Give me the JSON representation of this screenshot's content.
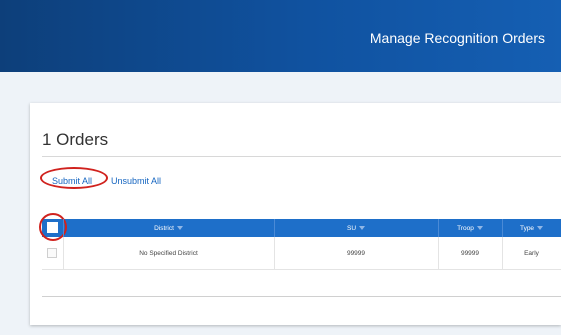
{
  "header": {
    "title": "Manage Recognition Orders",
    "bg_color": "#1052a0"
  },
  "orders": {
    "title": "1 Orders"
  },
  "actions": {
    "submit_all": "Submit All",
    "unsubmit_all": "Unsubmit All",
    "highlight_color": "#d0221e"
  },
  "table": {
    "header_color": "#1e6fc9",
    "columns": [
      "District",
      "SU",
      "Troop",
      "Type"
    ],
    "rows": [
      {
        "district": "No Specified District",
        "su": "99999",
        "troop": "99999",
        "type": "Early"
      }
    ]
  }
}
